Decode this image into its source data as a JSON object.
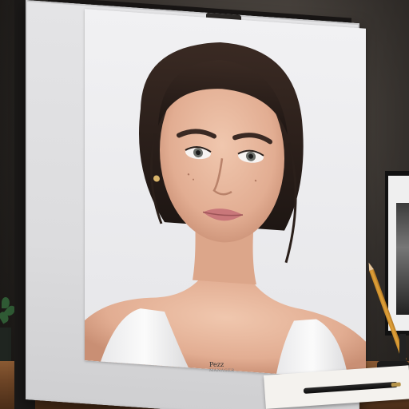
{
  "scene": {
    "board_signature": "Pezz",
    "board_signature_sub": "MANAGER"
  },
  "colors": {
    "wall": "#3a3531",
    "board": "#e2e2e4",
    "desk": "#7a4b29",
    "hair": "#2b1f1a",
    "skin": "#e6b69c",
    "lips": "#c9777a",
    "dress": "#f2f2f2"
  },
  "icons": {
    "pen": "pen-icon",
    "pencil": "pencil-icon",
    "plant": "plant-icon",
    "lamp": "lamp-icon",
    "framed_picture": "framed-picture-icon"
  }
}
